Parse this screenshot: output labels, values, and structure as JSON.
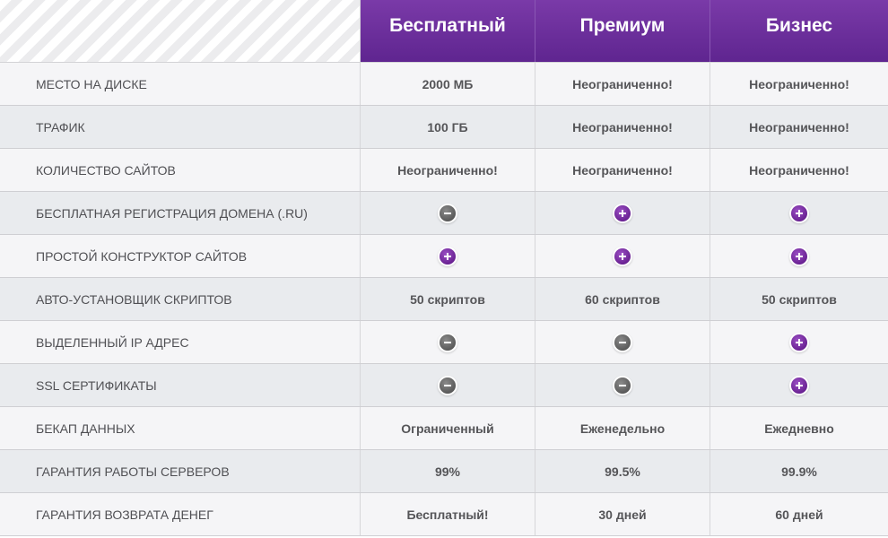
{
  "plans": [
    "Бесплатный",
    "Премиум",
    "Бизнес"
  ],
  "rows": [
    {
      "feature": "МЕСТО НА ДИСКЕ",
      "values": [
        {
          "type": "text",
          "text": "2000 МБ"
        },
        {
          "type": "text",
          "text": "Неограниченно!"
        },
        {
          "type": "text",
          "text": "Неограниченно!"
        }
      ]
    },
    {
      "feature": "ТРАФИК",
      "values": [
        {
          "type": "text",
          "text": "100 ГБ"
        },
        {
          "type": "text",
          "text": "Неограниченно!"
        },
        {
          "type": "text",
          "text": "Неограниченно!"
        }
      ]
    },
    {
      "feature": "КОЛИЧЕСТВО САЙТОВ",
      "values": [
        {
          "type": "text",
          "text": "Неограниченно!"
        },
        {
          "type": "text",
          "text": "Неограниченно!"
        },
        {
          "type": "text",
          "text": "Неограниченно!"
        }
      ]
    },
    {
      "feature": "БЕСПЛАТНАЯ РЕГИСТРАЦИЯ ДОМЕНА (.RU)",
      "values": [
        {
          "type": "icon",
          "icon": "minus-icon"
        },
        {
          "type": "icon",
          "icon": "plus-icon"
        },
        {
          "type": "icon",
          "icon": "plus-icon"
        }
      ]
    },
    {
      "feature": "ПРОСТОЙ КОНСТРУКТОР САЙТОВ",
      "values": [
        {
          "type": "icon",
          "icon": "plus-icon"
        },
        {
          "type": "icon",
          "icon": "plus-icon"
        },
        {
          "type": "icon",
          "icon": "plus-icon"
        }
      ]
    },
    {
      "feature": "АВТО-УСТАНОВЩИК СКРИПТОВ",
      "values": [
        {
          "type": "text",
          "text": "50 скриптов"
        },
        {
          "type": "text",
          "text": "60 скриптов"
        },
        {
          "type": "text",
          "text": "50 скриптов"
        }
      ]
    },
    {
      "feature": "ВЫДЕЛЕННЫЙ IP АДРЕС",
      "values": [
        {
          "type": "icon",
          "icon": "minus-icon"
        },
        {
          "type": "icon",
          "icon": "minus-icon"
        },
        {
          "type": "icon",
          "icon": "plus-icon"
        }
      ]
    },
    {
      "feature": "SSL СЕРТИФИКАТЫ",
      "values": [
        {
          "type": "icon",
          "icon": "minus-icon"
        },
        {
          "type": "icon",
          "icon": "minus-icon"
        },
        {
          "type": "icon",
          "icon": "plus-icon"
        }
      ]
    },
    {
      "feature": "БЕКАП ДАННЫХ",
      "values": [
        {
          "type": "text",
          "text": "Ограниченный"
        },
        {
          "type": "text",
          "text": "Еженедельно"
        },
        {
          "type": "text",
          "text": "Ежедневно"
        }
      ]
    },
    {
      "feature": "ГАРАНТИЯ РАБОТЫ СЕРВЕРОВ",
      "values": [
        {
          "type": "text",
          "text": "99%"
        },
        {
          "type": "text",
          "text": "99.5%"
        },
        {
          "type": "text",
          "text": "99.9%"
        }
      ]
    },
    {
      "feature": "ГАРАНТИЯ ВОЗВРАТА ДЕНЕГ",
      "values": [
        {
          "type": "text",
          "text": "Бесплатный!"
        },
        {
          "type": "text",
          "text": "30 дней"
        },
        {
          "type": "text",
          "text": "60 дней"
        }
      ]
    }
  ],
  "colors": {
    "header_top": "#7a3aa8",
    "header_bottom": "#5f2590",
    "plus_icon": "#6a2293",
    "minus_icon": "#5a5a5a",
    "row_odd": "#f5f5f7",
    "row_even": "#e9ebee"
  }
}
